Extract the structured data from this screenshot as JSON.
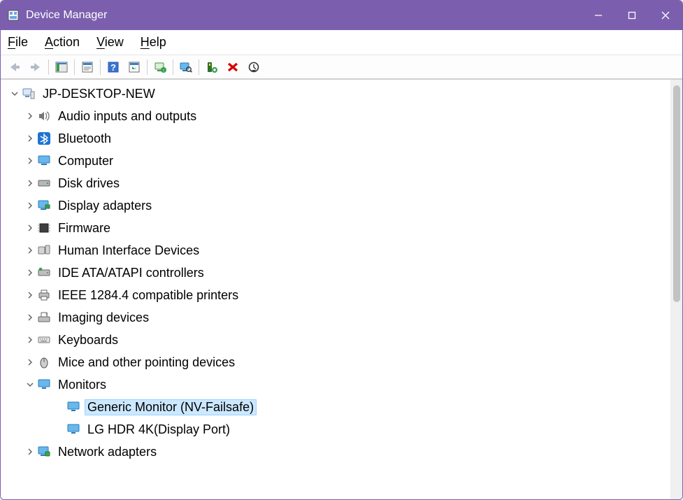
{
  "window": {
    "title": "Device Manager"
  },
  "menu": {
    "file": "File",
    "action": "Action",
    "view": "View",
    "help": "Help"
  },
  "toolbar_icons": {
    "back": "back-icon",
    "forward": "forward-icon",
    "showhide": "showhide-console-tree-icon",
    "properties": "properties-icon",
    "help": "help-icon",
    "options": "action-options-icon",
    "update": "update-driver-icon",
    "scan": "scan-hardware-icon",
    "addlegacy": "add-legacy-hardware-icon",
    "remove": "uninstall-device-icon",
    "disable": "disable-device-icon"
  },
  "tree": {
    "root": "JP-DESKTOP-NEW",
    "categories": [
      {
        "label": "Audio inputs and outputs",
        "icon": "speaker-icon"
      },
      {
        "label": "Bluetooth",
        "icon": "bluetooth-icon"
      },
      {
        "label": "Computer",
        "icon": "computer-icon"
      },
      {
        "label": "Disk drives",
        "icon": "disk-icon"
      },
      {
        "label": "Display adapters",
        "icon": "display-adapter-icon"
      },
      {
        "label": "Firmware",
        "icon": "firmware-icon"
      },
      {
        "label": "Human Interface Devices",
        "icon": "hid-icon"
      },
      {
        "label": "IDE ATA/ATAPI controllers",
        "icon": "ide-icon"
      },
      {
        "label": "IEEE 1284.4 compatible printers",
        "icon": "printer-icon"
      },
      {
        "label": "Imaging devices",
        "icon": "imaging-icon"
      },
      {
        "label": "Keyboards",
        "icon": "keyboard-icon"
      },
      {
        "label": "Mice and other pointing devices",
        "icon": "mouse-icon"
      },
      {
        "label": "Monitors",
        "icon": "monitor-icon",
        "expanded": true,
        "children": [
          {
            "label": "Generic Monitor (NV-Failsafe)",
            "icon": "monitor-icon",
            "selected": true
          },
          {
            "label": "LG HDR 4K(Display Port)",
            "icon": "monitor-icon"
          }
        ]
      },
      {
        "label": "Network adapters",
        "icon": "network-icon"
      }
    ]
  }
}
